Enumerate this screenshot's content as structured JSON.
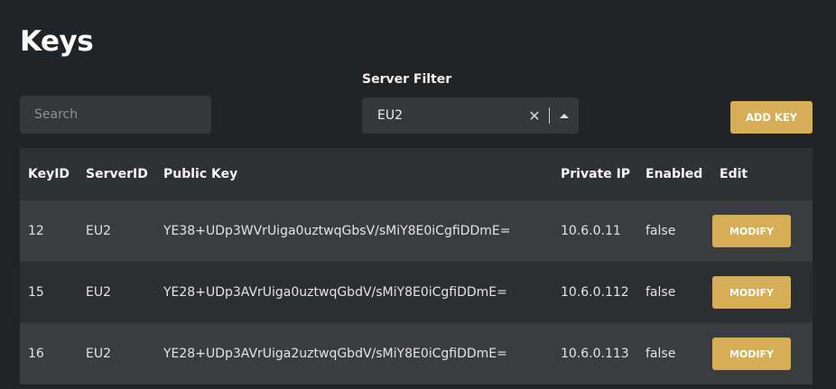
{
  "page": {
    "title": "Keys"
  },
  "search": {
    "placeholder": "Search",
    "value": ""
  },
  "server_filter": {
    "label": "Server Filter",
    "value": "EU2",
    "clear_glyph": "✕"
  },
  "actions": {
    "add_key_label": "ADD KEY"
  },
  "table": {
    "headers": {
      "key_id": "KeyID",
      "server_id": "ServerID",
      "public_key": "Public Key",
      "private_ip": "Private IP",
      "enabled": "Enabled",
      "edit": "Edit"
    },
    "rows": [
      {
        "key_id": "12",
        "server_id": "EU2",
        "public_key": "YE38+UDp3WVrUiga0uztwqGbsV/sMiY8E0iCgfiDDmE=",
        "private_ip": "10.6.0.11",
        "enabled": "false",
        "action": "MODIFY"
      },
      {
        "key_id": "15",
        "server_id": "EU2",
        "public_key": "YE28+UDp3AVrUiga0uztwqGbdV/sMiY8E0iCgfiDDmE=",
        "private_ip": "10.6.0.112",
        "enabled": "false",
        "action": "MODIFY"
      },
      {
        "key_id": "16",
        "server_id": "EU2",
        "public_key": "YE28+UDp3AVrUiga2uztwqGbdV/sMiY8E0iCgfiDDmE=",
        "private_ip": "10.6.0.113",
        "enabled": "false",
        "action": "MODIFY"
      }
    ]
  },
  "colors": {
    "background": "#222325",
    "accent": "#d6ae58",
    "input_bg": "#35373a",
    "row_alt": "#3a3c3f"
  }
}
